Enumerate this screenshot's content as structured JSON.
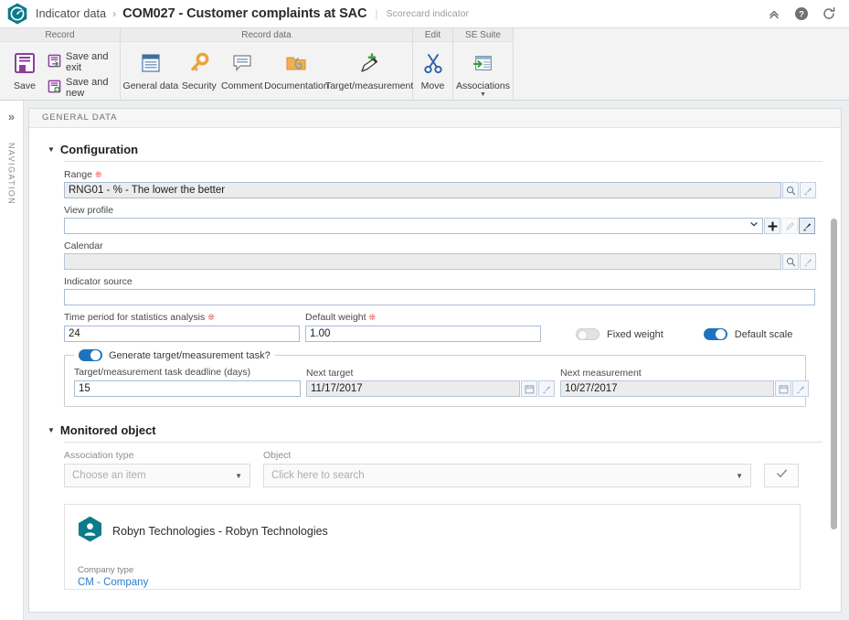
{
  "header": {
    "logo_icon": "gauge-hexagon-logo",
    "breadcrumb_root": "Indicator data",
    "breadcrumb_separator": "›",
    "title": "COM027 - Customer complaints at SAC",
    "divider": "|",
    "subtitle": "Scorecard indicator",
    "actions": [
      {
        "name": "collapse-ribbon-icon",
        "label": "collapse-up-icon"
      },
      {
        "name": "help-icon",
        "label": "help-icon"
      },
      {
        "name": "refresh-icon",
        "label": "refresh-icon"
      }
    ]
  },
  "ribbon": {
    "groups": [
      {
        "title": "Record",
        "big_button": {
          "label": "Save",
          "icon": "save-floppy-icon"
        },
        "stacked": [
          {
            "label": "Save and exit",
            "icon": "save-and-exit-icon"
          },
          {
            "label": "Save and new",
            "icon": "save-and-new-icon"
          }
        ]
      },
      {
        "title": "Record data",
        "buttons": [
          {
            "label": "General data",
            "icon": "general-data-icon"
          },
          {
            "label": "Security",
            "icon": "key-icon"
          },
          {
            "label": "Comment",
            "icon": "comment-icon"
          },
          {
            "label": "Documentation",
            "icon": "folder-attachment-icon"
          },
          {
            "label": "Target/measurement",
            "icon": "pen-plus-icon"
          }
        ]
      },
      {
        "title": "Edit",
        "buttons": [
          {
            "label": "Move",
            "icon": "scissors-icon"
          }
        ]
      },
      {
        "title": "SE Suite",
        "buttons": [
          {
            "label": "Associations",
            "icon": "associations-window-icon",
            "has_caret": true
          }
        ]
      }
    ]
  },
  "navrail": {
    "expand_icon": "chevron-double-right-icon",
    "label": "NAVIGATION"
  },
  "panel": {
    "tabs": [
      {
        "label": "GENERAL DATA",
        "active": true
      }
    ]
  },
  "configuration": {
    "title": "Configuration",
    "caret": "▼",
    "range": {
      "label": "Range",
      "required": true,
      "value": "RNG01 - % - The lower the better",
      "buttons": [
        {
          "name": "range-search-button",
          "icon": "magnifier-icon"
        },
        {
          "name": "range-clear-button",
          "icon": "eraser-brush-icon"
        }
      ]
    },
    "view_profile": {
      "label": "View profile",
      "required": false,
      "value": "",
      "buttons": [
        {
          "name": "view-profile-dropdown-button",
          "icon": "chevron-down-icon"
        },
        {
          "name": "view-profile-add-button",
          "icon": "plus-icon"
        },
        {
          "name": "view-profile-edit-button",
          "icon": "pencil-icon",
          "disabled": true
        },
        {
          "name": "view-profile-clear-button",
          "icon": "eraser-brush-icon",
          "active": true
        }
      ]
    },
    "calendar": {
      "label": "Calendar",
      "required": false,
      "value": "",
      "readonly": true,
      "buttons": [
        {
          "name": "calendar-search-button",
          "icon": "magnifier-icon"
        },
        {
          "name": "calendar-clear-button",
          "icon": "eraser-brush-icon"
        }
      ]
    },
    "indicator_source": {
      "label": "Indicator source",
      "required": false,
      "value": ""
    },
    "time_period": {
      "label": "Time period for statistics analysis",
      "required": true,
      "value": "24"
    },
    "default_weight": {
      "label": "Default weight",
      "required": true,
      "value": "1.00"
    },
    "fixed_weight": {
      "label": "Fixed weight",
      "state": "off"
    },
    "default_scale": {
      "label": "Default scale",
      "state": "on"
    },
    "task_box": {
      "legend": "Generate target/measurement task?",
      "toggle_state": "on",
      "deadline": {
        "label": "Target/measurement task deadline (days)",
        "value": "15"
      },
      "next_target": {
        "label": "Next target",
        "value": "11/17/2017",
        "buttons": [
          {
            "name": "next-target-calendar-button",
            "icon": "calendar-icon"
          },
          {
            "name": "next-target-clear-button",
            "icon": "eraser-brush-icon"
          }
        ]
      },
      "next_measurement": {
        "label": "Next measurement",
        "value": "10/27/2017",
        "buttons": [
          {
            "name": "next-measurement-calendar-button",
            "icon": "calendar-icon"
          },
          {
            "name": "next-measurement-clear-button",
            "icon": "eraser-brush-icon"
          }
        ]
      }
    }
  },
  "monitored_object": {
    "title": "Monitored object",
    "caret": "▼",
    "association_type": {
      "label": "Association type",
      "placeholder": "Choose an item"
    },
    "object": {
      "label": "Object",
      "placeholder": "Click here to search"
    },
    "confirm_button": {
      "name": "confirm-association-button",
      "icon": "check-icon"
    },
    "card": {
      "avatar_icon": "company-hexagon-avatar-icon",
      "title": "Robyn Technologies - Robyn Technologies",
      "type_label": "Company type",
      "type_value": "CM - Company"
    }
  },
  "colors": {
    "brand_teal": "#0c7b8a",
    "toggle_on": "#1e73be",
    "link_blue": "#2a7fc9",
    "required_red": "#e03030",
    "save_purple": "#8a3f9e",
    "key_yellow": "#e8a33d",
    "folder_orange": "#e8a94c",
    "scissors_blue": "#2f5fa8",
    "green_accent": "#3aa03a"
  }
}
